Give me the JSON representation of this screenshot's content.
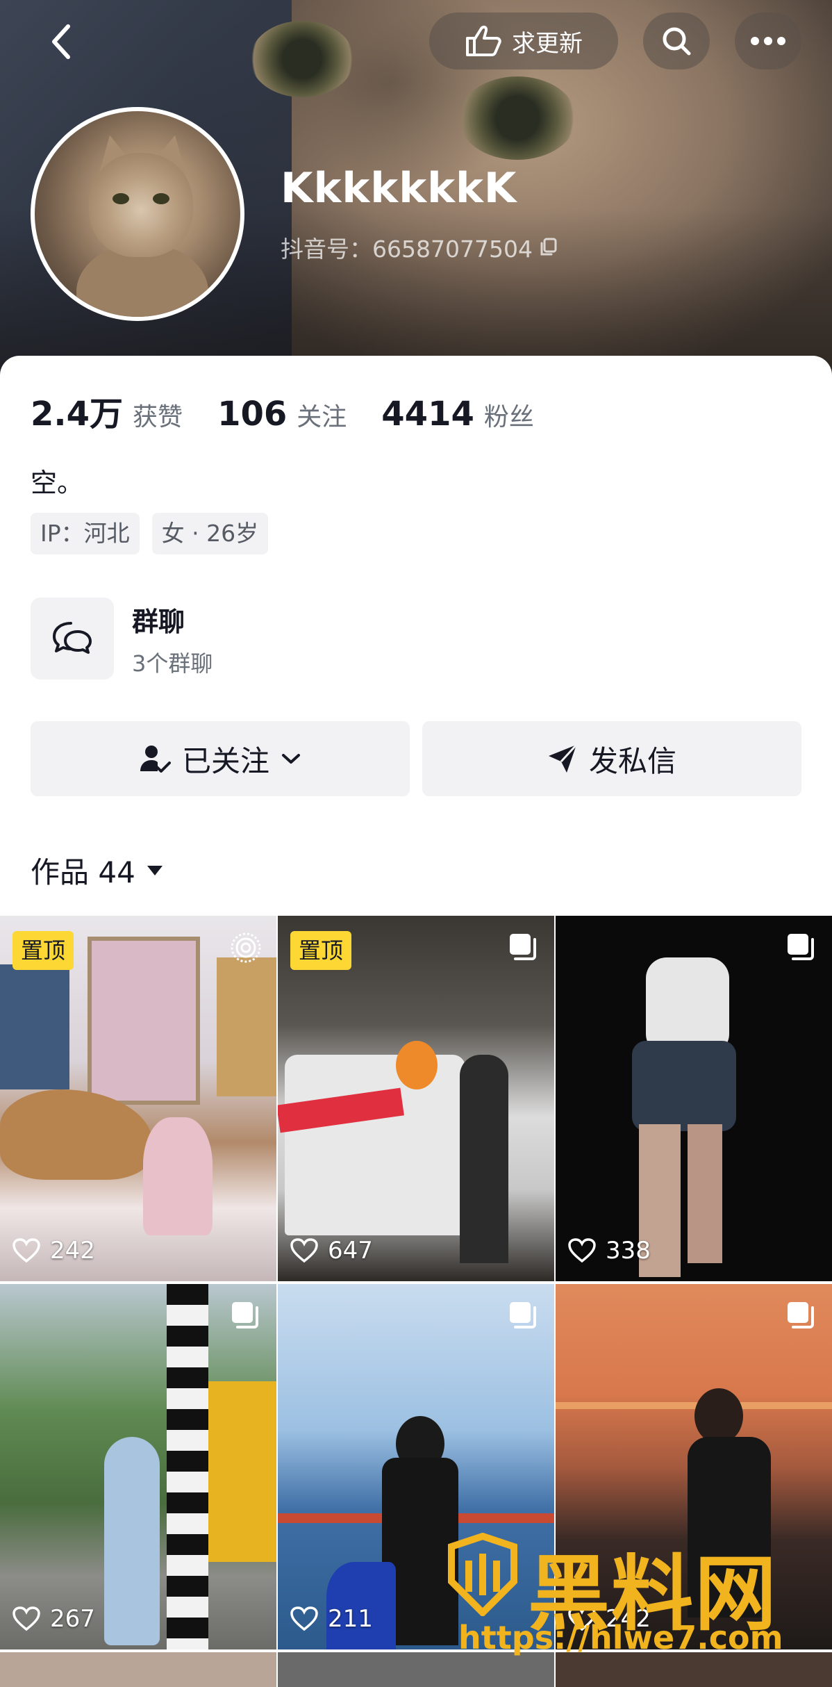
{
  "header": {
    "update_label": "求更新",
    "username": "KkkkkkkK",
    "douyin_id": "抖音号：66587077504"
  },
  "stats": {
    "likes_count": "2.4万",
    "likes_label": "获赞",
    "following_count": "106",
    "following_label": "关注",
    "followers_count": "4414",
    "followers_label": "粉丝"
  },
  "bio": "空。",
  "tags": [
    "IP：河北",
    "女 · 26岁"
  ],
  "group": {
    "title": "群聊",
    "subtitle": "3个群聊"
  },
  "actions": {
    "followed_label": "已关注",
    "message_label": "发私信"
  },
  "works": {
    "label": "作品 44"
  },
  "videos": [
    {
      "pinned": "置顶",
      "likes": "242",
      "icon": "live-icon"
    },
    {
      "pinned": "置顶",
      "likes": "647",
      "icon": "multi-image-icon"
    },
    {
      "pinned": "",
      "likes": "338",
      "icon": "multi-image-icon"
    },
    {
      "pinned": "",
      "likes": "267",
      "icon": "multi-image-icon"
    },
    {
      "pinned": "",
      "likes": "211",
      "icon": "multi-image-icon"
    },
    {
      "pinned": "",
      "likes": "242",
      "icon": "multi-image-icon"
    }
  ],
  "watermark": {
    "text": "黑料网",
    "url": "https://hlwe7.com"
  },
  "colors": {
    "pin_bg": "#fdd835",
    "watermark": "#f2b41e",
    "muted": "#69707a"
  }
}
